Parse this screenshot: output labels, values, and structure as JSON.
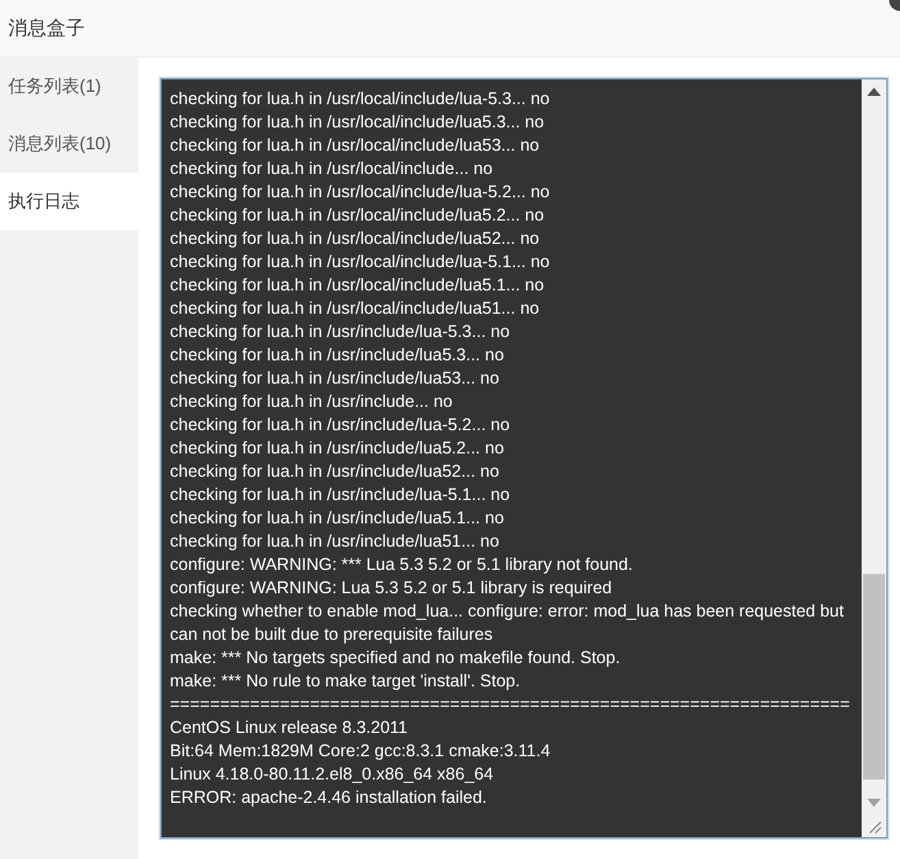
{
  "window": {
    "title": "消息盒子"
  },
  "sidebar": {
    "items": [
      {
        "label": "任务列表(1)",
        "selected": false
      },
      {
        "label": "消息列表(10)",
        "selected": false
      },
      {
        "label": "执行日志",
        "selected": true
      }
    ]
  },
  "log": {
    "lines": [
      "checking for lua.h in /usr/local/include/lua-5.3... no",
      "checking for lua.h in /usr/local/include/lua5.3... no",
      "checking for lua.h in /usr/local/include/lua53... no",
      "checking for lua.h in /usr/local/include... no",
      "checking for lua.h in /usr/local/include/lua-5.2... no",
      "checking for lua.h in /usr/local/include/lua5.2... no",
      "checking for lua.h in /usr/local/include/lua52... no",
      "checking for lua.h in /usr/local/include/lua-5.1... no",
      "checking for lua.h in /usr/local/include/lua5.1... no",
      "checking for lua.h in /usr/local/include/lua51... no",
      "checking for lua.h in /usr/include/lua-5.3... no",
      "checking for lua.h in /usr/include/lua5.3... no",
      "checking for lua.h in /usr/include/lua53... no",
      "checking for lua.h in /usr/include... no",
      "checking for lua.h in /usr/include/lua-5.2... no",
      "checking for lua.h in /usr/include/lua5.2... no",
      "checking for lua.h in /usr/include/lua52... no",
      "checking for lua.h in /usr/include/lua-5.1... no",
      "checking for lua.h in /usr/include/lua5.1... no",
      "checking for lua.h in /usr/include/lua51... no",
      "configure: WARNING: *** Lua 5.3 5.2 or 5.1 library not found.",
      "configure: WARNING: Lua 5.3 5.2 or 5.1 library is required",
      "checking whether to enable mod_lua... configure: error: mod_lua has been requested but can not be built due to prerequisite failures",
      "make: *** No targets specified and no makefile found.  Stop.",
      "make: *** No rule to make target 'install'.  Stop.",
      "====================================================================",
      "CentOS Linux release 8.3.2011",
      "Bit:64 Mem:1829M Core:2 gcc:8.3.1 cmake:3.11.4",
      "Linux 4.18.0-80.11.2.el8_0.x86_64 x86_64",
      "ERROR: apache-2.4.46 installation failed."
    ]
  }
}
